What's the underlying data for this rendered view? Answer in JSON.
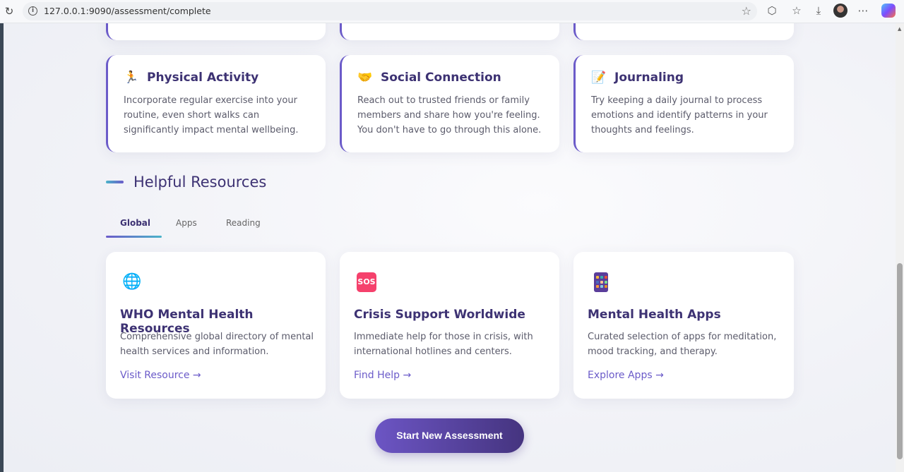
{
  "browser": {
    "url": "127.0.0.1:9090/assessment/complete"
  },
  "tips": [
    {
      "emoji": "🏃",
      "title": "Physical Activity",
      "desc": "Incorporate regular exercise into your routine, even short walks can significantly impact mental wellbeing."
    },
    {
      "emoji": "🤝",
      "title": "Social Connection",
      "desc": "Reach out to trusted friends or family members and share how you're feeling. You don't have to go through this alone."
    },
    {
      "emoji": "📝",
      "title": "Journaling",
      "desc": "Try keeping a daily journal to process emotions and identify patterns in your thoughts and feelings."
    }
  ],
  "resources": {
    "heading": "Helpful Resources",
    "tabs": [
      "Global",
      "Apps",
      "Reading"
    ],
    "active_tab": "Global",
    "cards": [
      {
        "icon": "globe-icon",
        "glyph": "🌐",
        "title": "WHO Mental Health Resources",
        "desc": "Comprehensive global directory of mental health services and information.",
        "link": "Visit Resource →"
      },
      {
        "icon": "sos-icon",
        "glyph": "SOS",
        "title": "Crisis Support Worldwide",
        "desc": "Immediate help for those in crisis, with international hotlines and centers.",
        "link": "Find Help →"
      },
      {
        "icon": "mobile-apps-icon",
        "glyph": "",
        "title": "Mental Health Apps",
        "desc": "Curated selection of apps for meditation, mood tracking, and therapy.",
        "link": "Explore Apps →"
      }
    ]
  },
  "cta": {
    "label": "Start New Assessment"
  },
  "colors": {
    "accent": "#6b5bc9",
    "heading": "#3d3273",
    "teal": "#4ab3c9",
    "sos": "#f5416c"
  }
}
